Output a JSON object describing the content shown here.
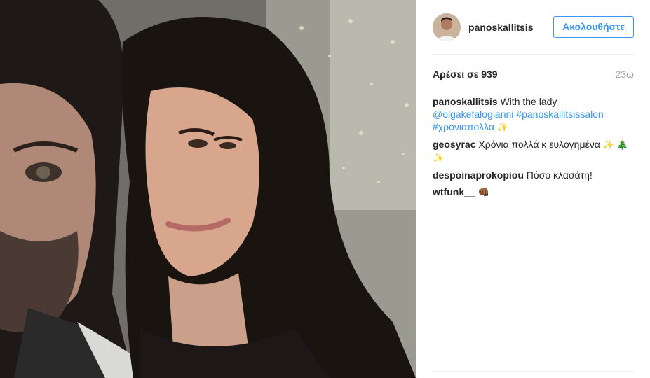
{
  "post": {
    "image_alt": "Selfie of a man and a woman with long dark hair in front of holiday lights",
    "author": "panoskallitsis",
    "follow_label": "Ακολουθήστε",
    "likes_text": "Αρέσει σε 939",
    "time_text": "23ω"
  },
  "caption": {
    "user": "panoskallitsis",
    "text": "With the lady",
    "mention": "@olgakefalogianni",
    "hashtag1": "#panoskallitsissalon",
    "hashtag2": "#χρονιαπολλα",
    "emoji": "✨"
  },
  "comments": [
    {
      "user": "geosyrac",
      "text": "Χρόνια πολλά κ ευλογημένα",
      "emoji": "✨ 🎄✨"
    },
    {
      "user": "despoinaprokopiou",
      "text": "Πόσο κλασάτη!",
      "emoji": ""
    },
    {
      "user": "wtfunk__",
      "text": "",
      "emoji": "👊🏾"
    }
  ],
  "colors": {
    "accent": "#3897f0",
    "text": "#262626",
    "muted": "#a5a7aa",
    "divider": "#efefef"
  },
  "icons": {
    "sparkles": "sparkles-icon",
    "tree": "christmas-tree-icon",
    "fist": "fist-bump-icon"
  }
}
